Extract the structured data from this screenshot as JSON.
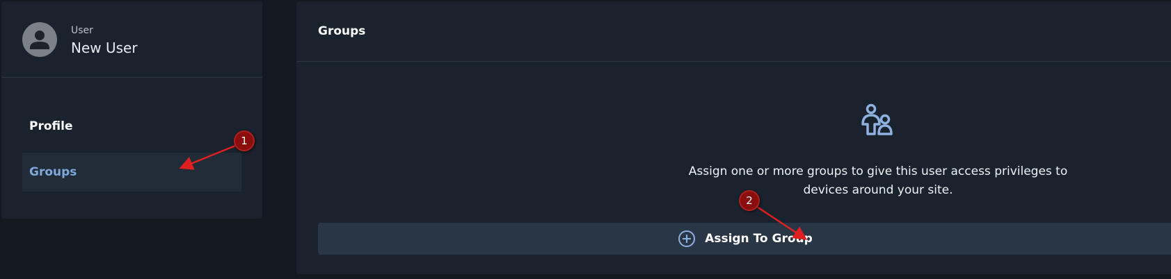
{
  "user": {
    "role_label": "User",
    "name": "New User",
    "avatar_icon": "person-icon"
  },
  "nav": {
    "items": [
      {
        "label": "Profile",
        "active": false
      },
      {
        "label": "Groups",
        "active": true
      }
    ]
  },
  "main": {
    "title": "Groups",
    "empty_icon": "groups-icon",
    "empty_message": "Assign one or more groups to give this user access privileges to devices around your site.",
    "assign_button": {
      "label": "Assign To Group",
      "icon": "plus-circle-icon"
    }
  },
  "annotations": {
    "markers": [
      "1",
      "2"
    ],
    "color": "#8b0e0e"
  },
  "colors": {
    "background": "#121921",
    "panel": "#1a222d",
    "active_nav_text": "#7fa8dc",
    "accent_icon": "#8fb1e0",
    "button_bg": "#293646"
  }
}
